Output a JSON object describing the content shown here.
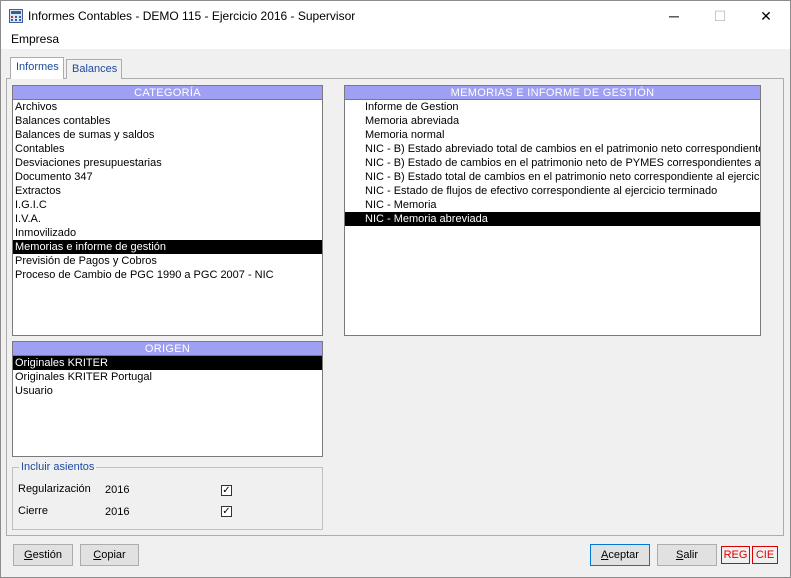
{
  "window": {
    "title": "Informes Contables - DEMO 115 - Ejercicio 2016 - Supervisor",
    "minimize": "─",
    "maximize": "☐",
    "close": "✕"
  },
  "menu": {
    "empresa": "Empresa"
  },
  "tabs": [
    {
      "label": "Informes"
    },
    {
      "label": "Balances"
    }
  ],
  "categoria": {
    "header": "CATEGORÍA",
    "items": [
      "Archivos",
      "Balances contables",
      "Balances de sumas y saldos",
      "Contables",
      "Desviaciones presupuestarias",
      "Documento 347",
      "Extractos",
      "I.G.I.C",
      "I.V.A.",
      "Inmovilizado",
      "Memorias e informe de gestión",
      "Previsión de Pagos y Cobros",
      "Proceso de Cambio de PGC 1990 a PGC 2007 - NIC"
    ],
    "selected_index": 10
  },
  "origen": {
    "header": "ORIGEN",
    "items": [
      "Originales KRITER",
      "Originales KRITER Portugal",
      "Usuario"
    ],
    "selected_index": 0
  },
  "memorias": {
    "header": "MEMORIAS E INFORME DE GESTIÓN",
    "items": [
      "Informe de Gestion",
      "Memoria abreviada",
      "Memoria normal",
      "NIC - B) Estado abreviado total de cambios en el patrimonio neto correspondiente a",
      "NIC - B) Estado de cambios en el patrimonio neto de PYMES correspondientes al ej",
      "NIC - B) Estado total de cambios en el patrimonio neto correspondiente al ejercicio t",
      "NIC - Estado de flujos de efectivo correspondiente al ejercicio terminado",
      "NIC - Memoria",
      "NIC - Memoria abreviada"
    ],
    "selected_index": 8
  },
  "incluir_asientos": {
    "legend": "Incluir asientos",
    "regularizacion": {
      "label": "Regularización",
      "year": "2016",
      "checked": true,
      "mark": "✓"
    },
    "cierre": {
      "label": "Cierre",
      "year": "2016",
      "checked": true,
      "mark": "✓"
    }
  },
  "buttons": {
    "gestion": {
      "first": "G",
      "rest": "estión"
    },
    "copiar": {
      "first": "C",
      "rest": "opiar"
    },
    "aceptar": {
      "first": "A",
      "rest": "ceptar"
    },
    "salir": {
      "first": "S",
      "rest": "alir"
    }
  },
  "status": {
    "reg": "REG",
    "cie": "CIE"
  },
  "colors": {
    "list_header": "#9f9ff3",
    "selection": "#000000",
    "status_red": "#dd0000"
  }
}
